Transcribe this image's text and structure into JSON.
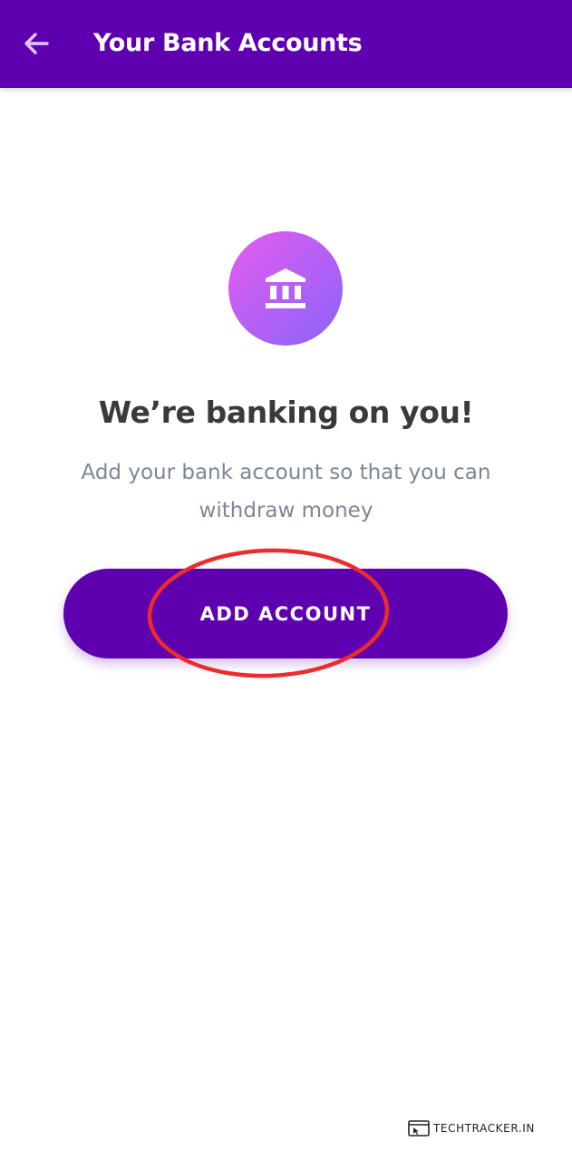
{
  "app_bar": {
    "title": "Your Bank Accounts",
    "background_color": "#5f00b0",
    "back_icon": "arrow-left-icon"
  },
  "empty_state": {
    "icon": "bank-icon",
    "icon_gradient": [
      "#e65bef",
      "#8a63f7"
    ],
    "headline": "We’re banking on you!",
    "subtext": "Add your bank account so that you can withdraw money"
  },
  "actions": {
    "add_account_label": "ADD ACCOUNT",
    "button_color": "#5f00b0"
  },
  "annotation": {
    "color": "#ec2b2b"
  },
  "watermark": {
    "text": "TECHTRACKER.IN",
    "icon": "browser-cursor-icon"
  }
}
